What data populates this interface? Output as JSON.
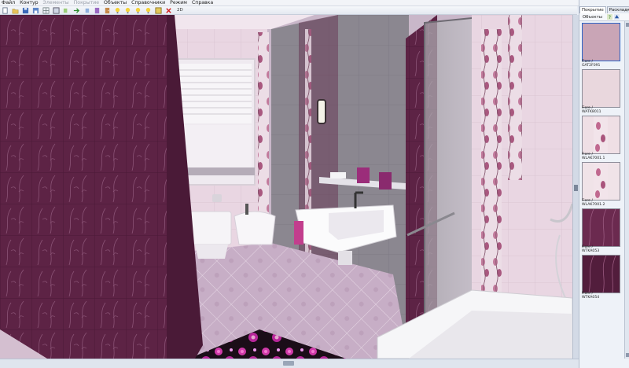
{
  "menu": [
    "Файл",
    "Контур",
    "Элементы",
    "Покрытие",
    "Объекты",
    "Справочники",
    "Режим",
    "Справка"
  ],
  "menu_disabled": [
    false,
    false,
    true,
    true,
    false,
    false,
    false,
    false
  ],
  "toolbar": {
    "icons": [
      "new-file-icon",
      "open-folder-icon",
      "save-icon",
      "save-as-icon",
      "grid-icon",
      "layout-icon",
      "import-icon",
      "arrow-icon",
      "export-icon",
      "book-icon",
      "door-icon",
      "bulb-icon",
      "bulb-icon",
      "bulb-icon",
      "bulb-icon",
      "window-icon",
      "delete-icon"
    ],
    "mode_2d": "2D"
  },
  "panel": {
    "tabs": [
      "Покрытие",
      "Раскладки"
    ],
    "active_tab": 0,
    "sub_label": "Объекты",
    "items": [
      {
        "caption": "Fiore /\nGAT2F091",
        "color": "#c9a5b6",
        "selected": true
      },
      {
        "caption": "Fiore /\nWATK8011",
        "color": "#e9d7dd",
        "selected": false
      },
      {
        "caption": "Fiore /\nWLAK7001.1",
        "color": "#efdfe5",
        "selected": false
      },
      {
        "caption": "Fiore /\nWLAK7001.2",
        "color": "#f0e3e8",
        "selected": false
      },
      {
        "caption": "Fiore /\nWTKA053",
        "color": "#6b2a4f",
        "selected": false
      },
      {
        "caption": "Fiore /\nWTKA054",
        "color": "#521d3c",
        "selected": false
      }
    ]
  },
  "colors": {
    "plum_tile": "#5f2547",
    "light_tile": "#e6d4df",
    "floor": "#cbb3c9",
    "grey_wall": "#8a8690"
  }
}
